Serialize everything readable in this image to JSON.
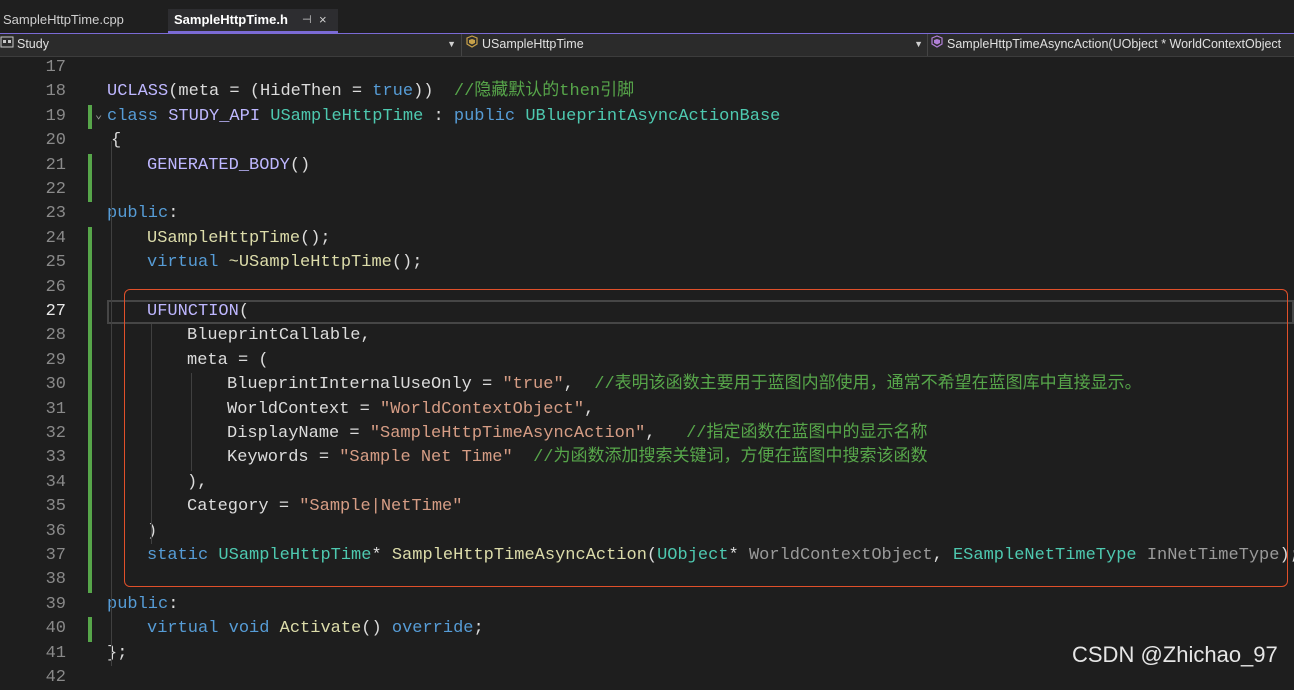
{
  "tabs": {
    "inactive_label": "SampleHttpTime.cpp",
    "active_label": "SampleHttpTime.h",
    "pin_glyph": "⊣",
    "close_glyph": "×"
  },
  "navbar": {
    "project": "Study",
    "class_scope": "USampleHttpTime",
    "member": "SampleHttpTimeAsyncAction(UObject * WorldContextObject"
  },
  "lines": [
    {
      "n": "17",
      "code": ""
    },
    {
      "n": "18",
      "code": "UCLASS(meta = (HideThen = true))  //隐藏默认的then引脚"
    },
    {
      "n": "19",
      "code": "class STUDY_API USampleHttpTime : public UBlueprintAsyncActionBase"
    },
    {
      "n": "20",
      "code": "{"
    },
    {
      "n": "21",
      "code": "GENERATED_BODY()"
    },
    {
      "n": "22",
      "code": ""
    },
    {
      "n": "23",
      "code": "public:"
    },
    {
      "n": "24",
      "code": "USampleHttpTime();"
    },
    {
      "n": "25",
      "code": "virtual ~USampleHttpTime();"
    },
    {
      "n": "26",
      "code": ""
    },
    {
      "n": "27",
      "code": "UFUNCTION("
    },
    {
      "n": "28",
      "code": "BlueprintCallable,"
    },
    {
      "n": "29",
      "code": "meta = ("
    },
    {
      "n": "30",
      "code": "BlueprintInternalUseOnly = \"true\",  //表明该函数主要用于蓝图内部使用，通常不希望在蓝图库中直接显示。"
    },
    {
      "n": "31",
      "code": "WorldContext = \"WorldContextObject\","
    },
    {
      "n": "32",
      "code": "DisplayName = \"SampleHttpTimeAsyncAction\",   //指定函数在蓝图中的显示名称"
    },
    {
      "n": "33",
      "code": "Keywords = \"Sample Net Time\"  //为函数添加搜索关键词，方便在蓝图中搜索该函数"
    },
    {
      "n": "34",
      "code": "),"
    },
    {
      "n": "35",
      "code": "Category = \"Sample|NetTime\""
    },
    {
      "n": "36",
      "code": ")"
    },
    {
      "n": "37",
      "code": "static USampleHttpTime* SampleHttpTimeAsyncAction(UObject* WorldContextObject, ESampleNetTimeType InNetTimeType);"
    },
    {
      "n": "38",
      "code": ""
    },
    {
      "n": "39",
      "code": "public:"
    },
    {
      "n": "40",
      "code": "virtual void Activate() override;"
    },
    {
      "n": "41",
      "code": "};"
    },
    {
      "n": "42",
      "code": ""
    }
  ],
  "watermark": "CSDN @Zhichao_97",
  "colors": {
    "background": "#1e1e1e",
    "keyword": "#569cd6",
    "type": "#4ec9b0",
    "macro": "#beb7ff",
    "string": "#d69d85",
    "comment": "#57a64a",
    "function": "#dcdcaa",
    "highlight_box": "#e0502a",
    "tab_accent": "#7b6bd6"
  },
  "current_line": "27"
}
